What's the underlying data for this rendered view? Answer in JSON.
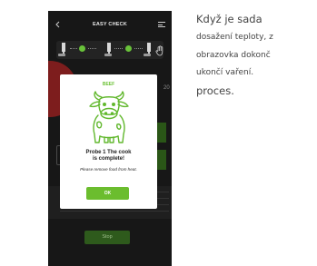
{
  "app": {
    "title": "EASY CHECK"
  },
  "probe_strip": {
    "probe_count": 3
  },
  "background": {
    "partial_number": "20",
    "stop_label": "Stop"
  },
  "modal": {
    "title": "BEEF",
    "icon": "cow-icon",
    "heading_line1": "Probe 1 The cook",
    "heading_line2": "is complete!",
    "message": "Please remove food from heat.",
    "ok_label": "OK"
  },
  "caption": {
    "line1": "Když je sada",
    "line2": "dosažení teploty, z",
    "line3": "obrazovka dokonč",
    "line4": "ukončí vaření.",
    "line5": "proces."
  },
  "colors": {
    "accent": "#6bbd2e",
    "phone_bg": "#171717",
    "dim_red": "#7d1d1d"
  }
}
